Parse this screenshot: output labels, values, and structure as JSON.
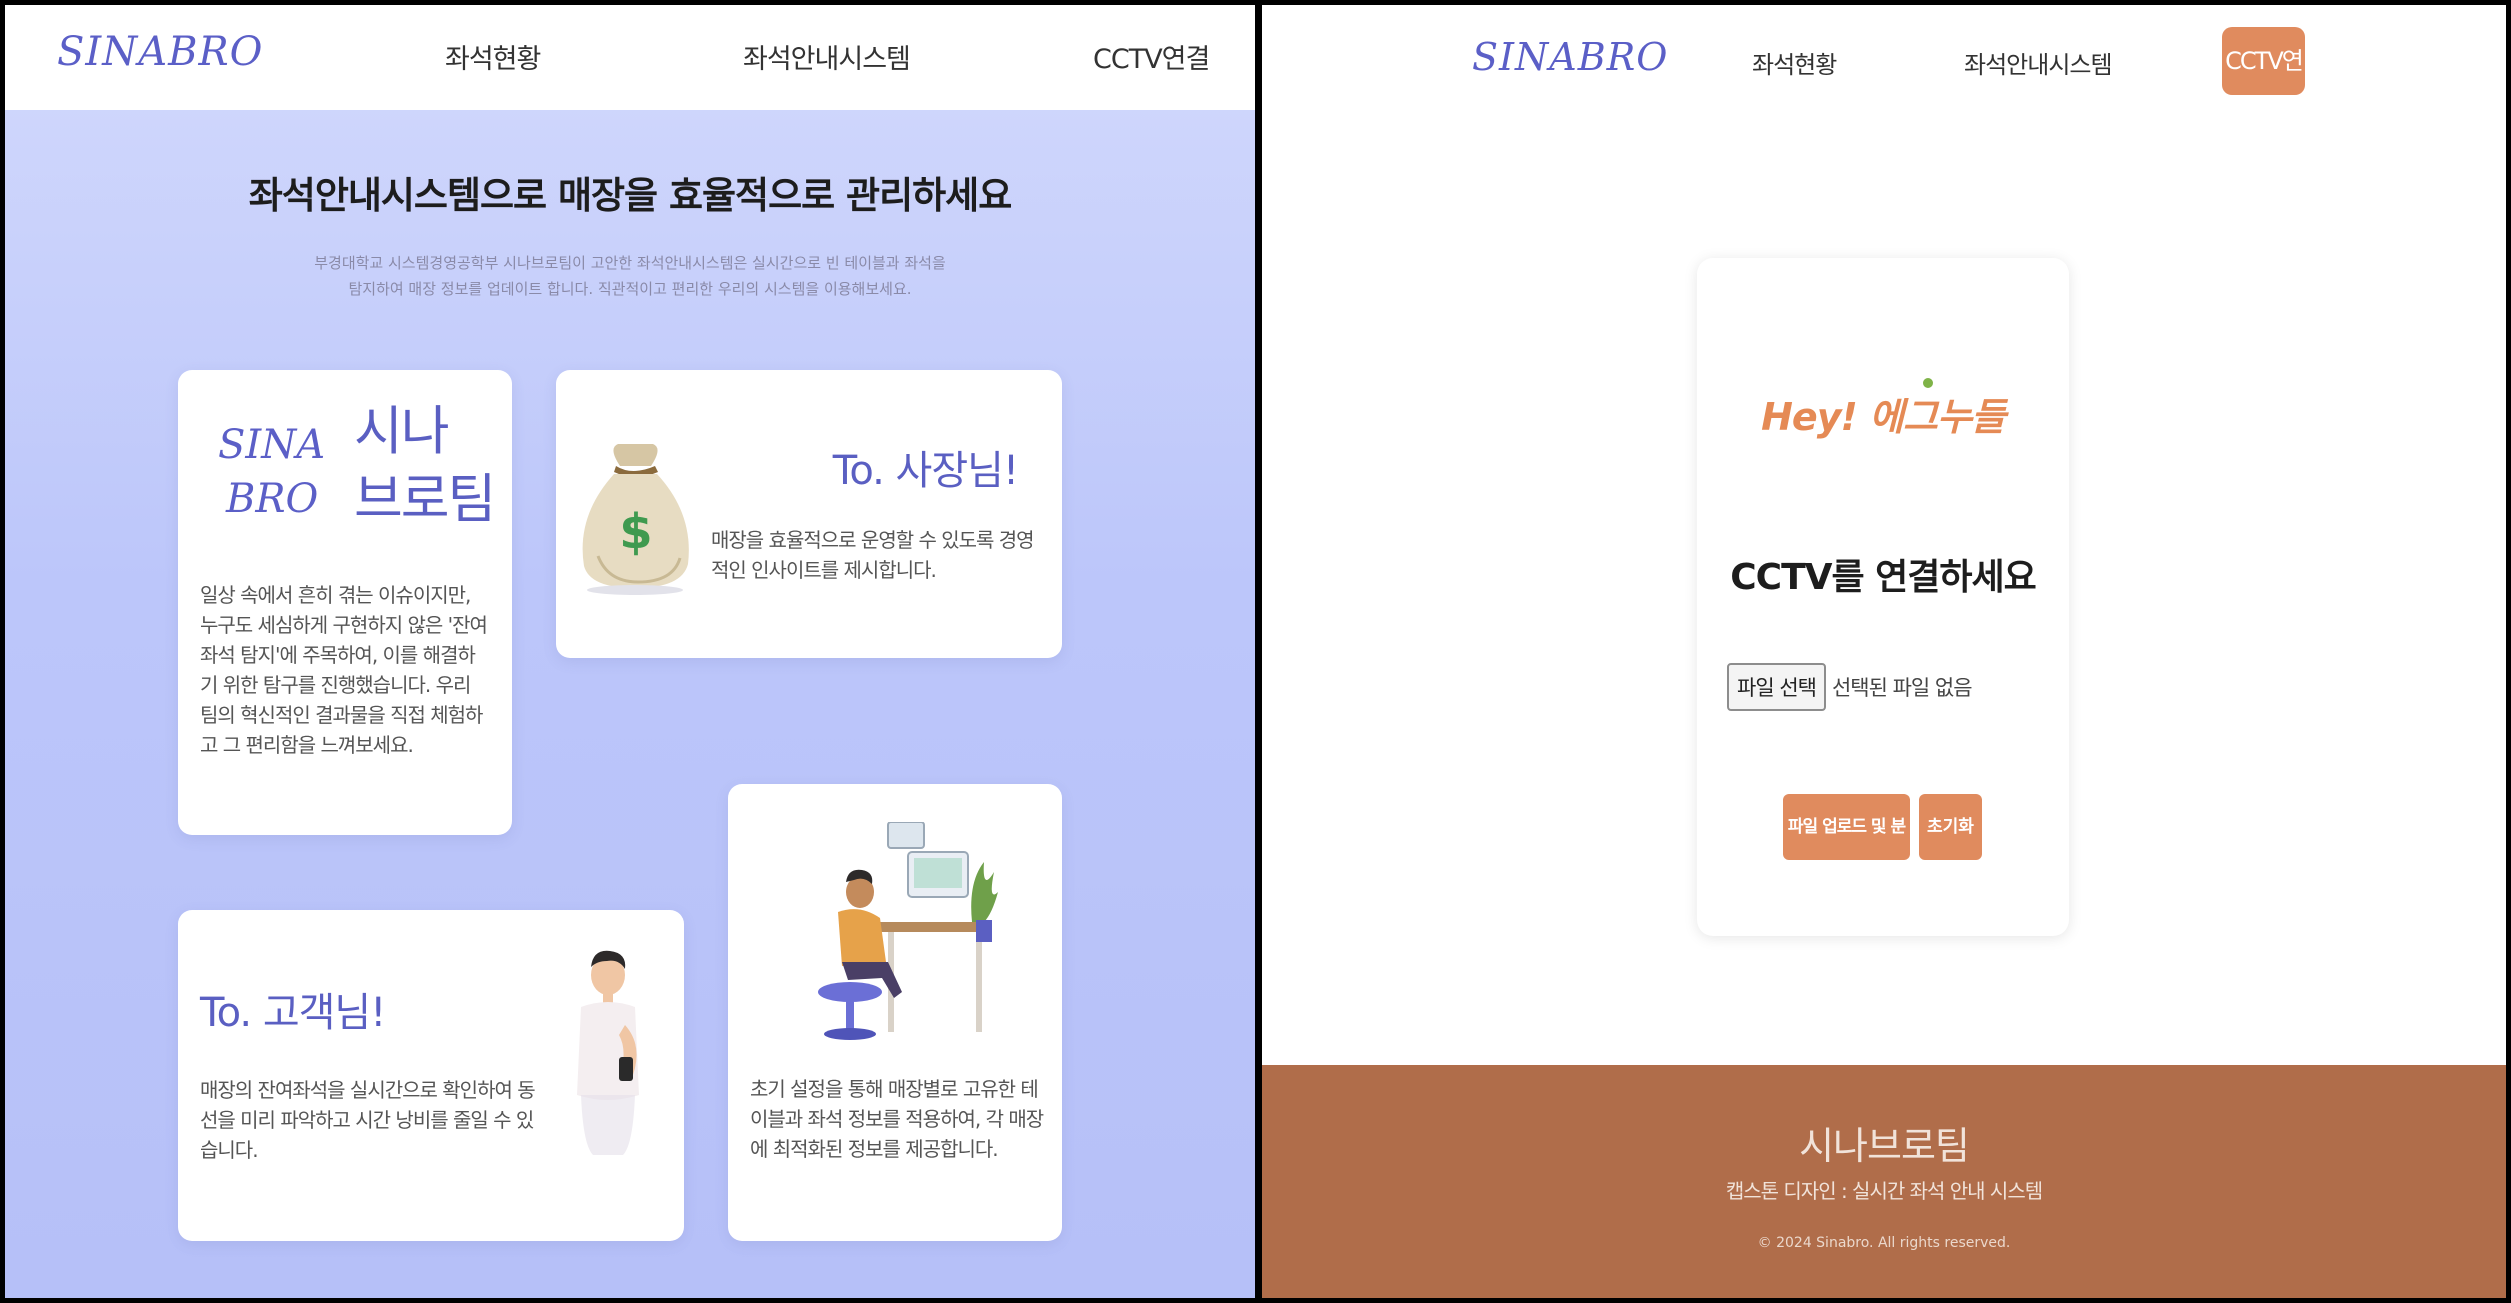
{
  "left_page": {
    "nav": {
      "logo": "SINABRO",
      "items": [
        "좌석현황",
        "좌석안내시스템",
        "CCTV연결"
      ]
    },
    "hero": {
      "title": "좌석안내시스템으로 매장을 효율적으로 관리하세요",
      "subtitle_line1": "부경대학교 시스템경영공학부 시나브로팀이 고안한 좌석안내시스템은 실시간으로 빈 테이블과 좌석을",
      "subtitle_line2": "탐지하여 매장 정보를 업데이트 합니다. 직관적이고 편리한 우리의 시스템을 이용해보세요."
    },
    "cards": {
      "team": {
        "logo_line1": "SINA",
        "logo_line2": "BRO",
        "name_line1": "시나",
        "name_line2": "브로팀",
        "desc": "일상 속에서 흔히 겪는 이슈이지만, 누구도 세심하게 구현하지 않은 '잔여좌석 탐지'에 주목하여, 이를 해결하기 위한 탐구를 진행했습니다. 우리 팀의 혁신적인 결과물을 직접 체험하고 그 편리함을 느껴보세요."
      },
      "owner": {
        "title": "To. 사장님!",
        "desc": "매장을 효율적으로 운영할 수 있도록 경영적인 인사이트를 제시합니다."
      },
      "customer": {
        "title": "To. 고객님!",
        "desc": "매장의 잔여좌석을 실시간으로 확인하여 동선을 미리 파악하고 시간 낭비를 줄일 수 있습니다."
      },
      "setup": {
        "desc": "초기 설정을 통해 매장별로 고유한 테이블과 좌석 정보를 적용하여, 각 매장에 최적화된 정보를 제공합니다."
      }
    }
  },
  "right_page": {
    "nav": {
      "logo": "SINABRO",
      "items": [
        "좌석현황",
        "좌석안내시스템"
      ],
      "active_item": "CCTV연결"
    },
    "upload": {
      "brand": "Hey! 에그누들",
      "title": "CCTV를 연결하세요",
      "file_button": "파일 선택",
      "file_status": "선택된 파일 없음",
      "upload_button": "파일 업로드 및 분석",
      "reset_button": "초기화"
    },
    "footer": {
      "title": "시나브로팀",
      "subtitle": "캡스톤 디자인 : 실시간 좌석 안내 시스템",
      "copyright": "© 2024 Sinabro. All rights reserved."
    }
  },
  "colors": {
    "accent_purple": "#5a5fc2",
    "accent_orange": "#e08b5e",
    "footer_brown": "#b06d4a",
    "left_bg": "#bcc6fa"
  }
}
